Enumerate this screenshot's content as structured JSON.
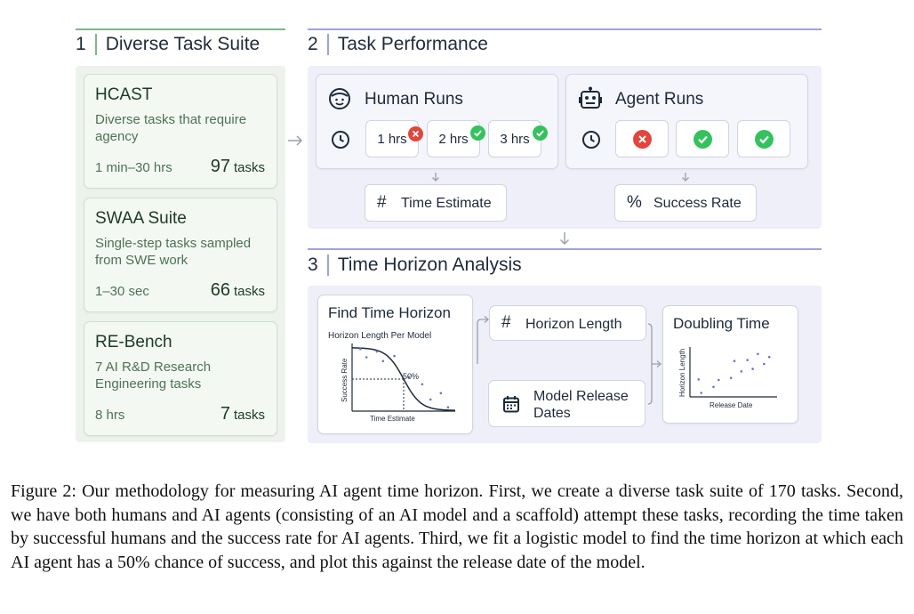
{
  "colors": {
    "green_rule": "#7fb68a",
    "green_panel": "#edf3ec",
    "green_text": "#4d7254",
    "purple_rule": "#9ea3dc",
    "purple_panel": "#eeeff8",
    "check_green": "#35c25e",
    "cross_red": "#e2453c"
  },
  "section1": {
    "number": "1",
    "title": "Diverse Task Suite",
    "cards": [
      {
        "title": "HCAST",
        "desc": "Diverse tasks that require agency",
        "time": "1 min–30 hrs",
        "count": "97",
        "unit": "tasks"
      },
      {
        "title": "SWAA Suite",
        "desc": "Single-step tasks sampled from SWE work",
        "time": "1–30 sec",
        "count": "66",
        "unit": "tasks"
      },
      {
        "title": "RE-Bench",
        "desc": "7 AI R&D Research Engineering tasks",
        "time": "8 hrs",
        "count": "7",
        "unit": "tasks"
      }
    ]
  },
  "section2": {
    "number": "2",
    "title": "Task Performance",
    "human": {
      "title": "Human Runs",
      "icon": "smiley-face-icon",
      "runs": [
        {
          "label": "1 hrs",
          "result": "fail"
        },
        {
          "label": "2 hrs",
          "result": "success"
        },
        {
          "label": "3 hrs",
          "result": "success"
        }
      ]
    },
    "agent": {
      "title": "Agent Runs",
      "icon": "robot-icon",
      "runs": [
        "fail",
        "success",
        "success"
      ]
    },
    "time_estimate": {
      "symbol": "#",
      "label": "Time Estimate"
    },
    "success_rate": {
      "symbol": "%",
      "label": "Success Rate"
    }
  },
  "section3": {
    "number": "3",
    "title": "Time Horizon Analysis",
    "find": {
      "title": "Find Time Horizon",
      "chart_title": "Horizon Length Per Model",
      "xlabel": "Time Estimate",
      "ylabel": "Success Rate",
      "marker_label": "50%"
    },
    "horizon_length": {
      "symbol": "#",
      "label": "Horizon Length"
    },
    "release_dates": {
      "label": "Model Release Dates",
      "icon": "calendar-icon"
    },
    "doubling": {
      "title": "Doubling Time",
      "xlabel": "Release Date",
      "ylabel": "Horizon Length"
    }
  },
  "chart_data": [
    {
      "type": "scatter",
      "title": "Horizon Length Per Model",
      "xlabel": "Time Estimate",
      "ylabel": "Success Rate",
      "grid": false,
      "points": [
        [
          0.08,
          0.97
        ],
        [
          0.14,
          0.84
        ],
        [
          0.24,
          0.93
        ],
        [
          0.3,
          0.78
        ],
        [
          0.41,
          0.86
        ],
        [
          0.55,
          0.53
        ],
        [
          0.68,
          0.42
        ],
        [
          0.76,
          0.18
        ],
        [
          0.86,
          0.28
        ],
        [
          0.93,
          0.06
        ]
      ],
      "fit": "logistic",
      "annotation": "50%"
    },
    {
      "type": "scatter",
      "xlabel": "Release Date",
      "ylabel": "Horizon Length",
      "grid": false,
      "points": [
        [
          0.1,
          0.35
        ],
        [
          0.13,
          0.08
        ],
        [
          0.27,
          0.2
        ],
        [
          0.33,
          0.34
        ],
        [
          0.47,
          0.38
        ],
        [
          0.51,
          0.72
        ],
        [
          0.59,
          0.51
        ],
        [
          0.66,
          0.74
        ],
        [
          0.72,
          0.56
        ],
        [
          0.78,
          0.86
        ],
        [
          0.85,
          0.66
        ],
        [
          0.91,
          0.8
        ]
      ]
    }
  ],
  "caption": "Figure 2: Our methodology for measuring AI agent time horizon. First, we create a diverse task suite of 170 tasks. Second, we have both humans and AI agents (consisting of an AI model and a scaffold) attempt these tasks, recording the time taken by successful humans and the success rate for AI agents. Third, we fit a logistic model to find the time horizon at which each AI agent has a 50% chance of success, and plot this against the release date of the model."
}
